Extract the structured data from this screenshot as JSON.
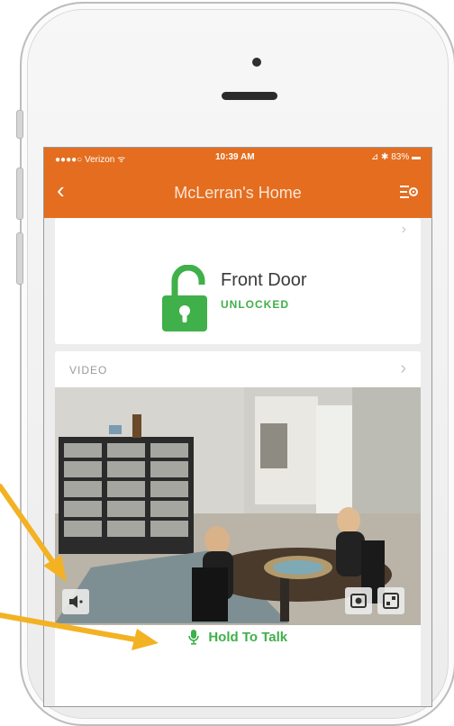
{
  "status_bar": {
    "carrier": "●●●●○ Verizon ᯤ",
    "time": "10:39 AM",
    "battery": "⊿ ✱ 83% ▬"
  },
  "nav": {
    "title": "McLerran's Home",
    "back_icon": "chevron-left-icon",
    "menu_icon": "list-settings-icon"
  },
  "lock": {
    "name": "Front Door",
    "status": "UNLOCKED",
    "status_color": "#3fb04a",
    "icon": "unlocked-padlock-icon"
  },
  "video": {
    "header": "VIDEO",
    "speaker_icon": "speaker-icon",
    "snapshot_icon": "snapshot-icon",
    "fullscreen_icon": "fullscreen-icon"
  },
  "talk": {
    "label": "Hold To Talk",
    "icon": "microphone-icon"
  },
  "colors": {
    "accent": "#e46d1f",
    "arrow": "#f3b223",
    "green": "#3fb04a"
  }
}
